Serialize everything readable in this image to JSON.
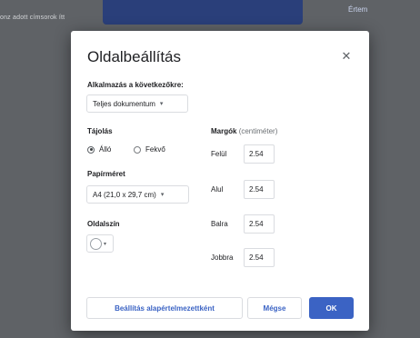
{
  "background": {
    "doc_text": "onz adott címsorok ítt",
    "banner_button": "Értem"
  },
  "dialog": {
    "title": "Oldalbeállítás",
    "close_icon": "close-icon",
    "apply_to": {
      "label": "Alkalmazás a következőkre:",
      "value": "Teljes dokumentum"
    },
    "orientation": {
      "label": "Tájolás",
      "options": [
        "Álló",
        "Fekvő"
      ],
      "selected": "Álló"
    },
    "paper_size": {
      "label": "Papírméret",
      "value": "A4 (21,0 x 29,7 cm)"
    },
    "page_color": {
      "label": "Oldalszín",
      "value": "#ffffff"
    },
    "margins": {
      "label": "Margók",
      "unit": "(centiméter)",
      "items": [
        {
          "label": "Felül",
          "value": "2.54"
        },
        {
          "label": "Alul",
          "value": "2.54"
        },
        {
          "label": "Balra",
          "value": "2.54"
        },
        {
          "label": "Jobbra",
          "value": "2.54"
        }
      ]
    },
    "buttons": {
      "set_default": "Beállítás alapértelmezettként",
      "cancel": "Mégse",
      "ok": "OK"
    },
    "colors": {
      "accent": "#3b63c4",
      "overlay": "#5f6266"
    }
  }
}
